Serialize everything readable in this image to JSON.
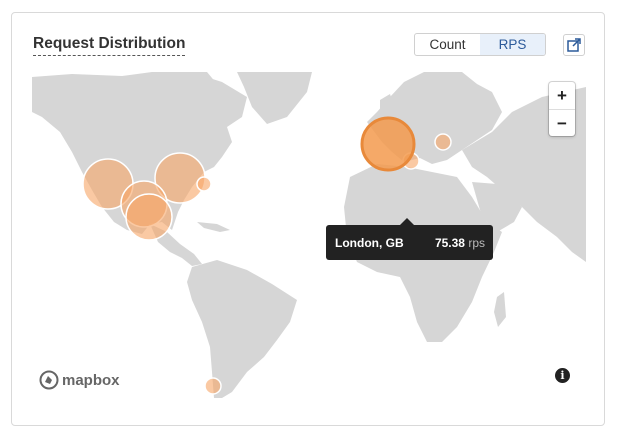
{
  "panel": {
    "title": "Request Distribution"
  },
  "toggle": {
    "options": [
      "Count",
      "RPS"
    ],
    "selected": "RPS"
  },
  "expand": {
    "icon": "external-expand-icon"
  },
  "map": {
    "zoom_in_label": "+",
    "zoom_out_label": "−",
    "attribution": "mapbox",
    "info_label": "i",
    "marker_color": "#f6a565",
    "highlight_color": "#f39a4e",
    "land_color": "#d6d6d6"
  },
  "tooltip": {
    "location": "London, GB",
    "value": "75.38",
    "unit": "rps"
  }
}
